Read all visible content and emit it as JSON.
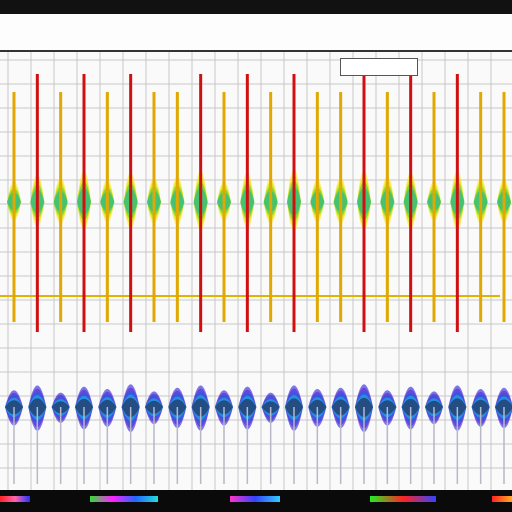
{
  "page": {
    "title": "",
    "legend_text": ""
  },
  "colors": {
    "background": "#fafafa",
    "grid": "#c8c8c8",
    "spike": "#d01010",
    "baseline": "#e0b400",
    "upper_band": [
      "#ffe600",
      "#c8e000",
      "#3cc83c",
      "#12b4a0"
    ],
    "lower_band": [
      "#2a1ee0",
      "#5a28c8",
      "#1a60e8",
      "#1ab4e0",
      "#222244"
    ]
  },
  "chart_data": [
    {
      "type": "line",
      "title": "",
      "xlabel": "",
      "ylabel": "",
      "grid": true,
      "legend": "top-right",
      "x": [
        1,
        2,
        3,
        4,
        5,
        6,
        7,
        8,
        9,
        10,
        11,
        12,
        13,
        14,
        15,
        16,
        17,
        18,
        19,
        20,
        21,
        22
      ],
      "series": [
        {
          "color": "#d01010",
          "values": [
            0,
            1,
            0,
            1,
            0,
            1,
            0,
            0,
            1,
            0,
            1,
            0,
            1,
            0,
            0,
            1,
            0,
            1,
            0,
            1,
            0,
            0
          ]
        },
        {
          "color": "#6cc83c",
          "values": [
            0.6,
            0.8,
            0.7,
            0.9,
            0.65,
            0.85,
            0.7,
            0.75,
            0.9,
            0.6,
            0.85,
            0.7,
            0.95,
            0.65,
            0.7,
            0.9,
            0.75,
            0.85,
            0.6,
            0.9,
            0.7,
            0.65
          ]
        }
      ]
    },
    {
      "type": "line",
      "title": "",
      "xlabel": "",
      "ylabel": "",
      "grid": true,
      "legend": "none",
      "x": [
        1,
        2,
        3,
        4,
        5,
        6,
        7,
        8,
        9,
        10,
        11,
        12,
        13,
        14,
        15,
        16,
        17,
        18,
        19,
        20,
        21,
        22
      ],
      "series": [
        {
          "color": "#2a1ee0",
          "values": [
            0.7,
            0.9,
            0.6,
            0.85,
            0.75,
            0.95,
            0.65,
            0.8,
            0.9,
            0.7,
            0.85,
            0.6,
            0.9,
            0.75,
            0.8,
            0.95,
            0.7,
            0.85,
            0.65,
            0.9,
            0.75,
            0.8
          ]
        }
      ]
    }
  ]
}
